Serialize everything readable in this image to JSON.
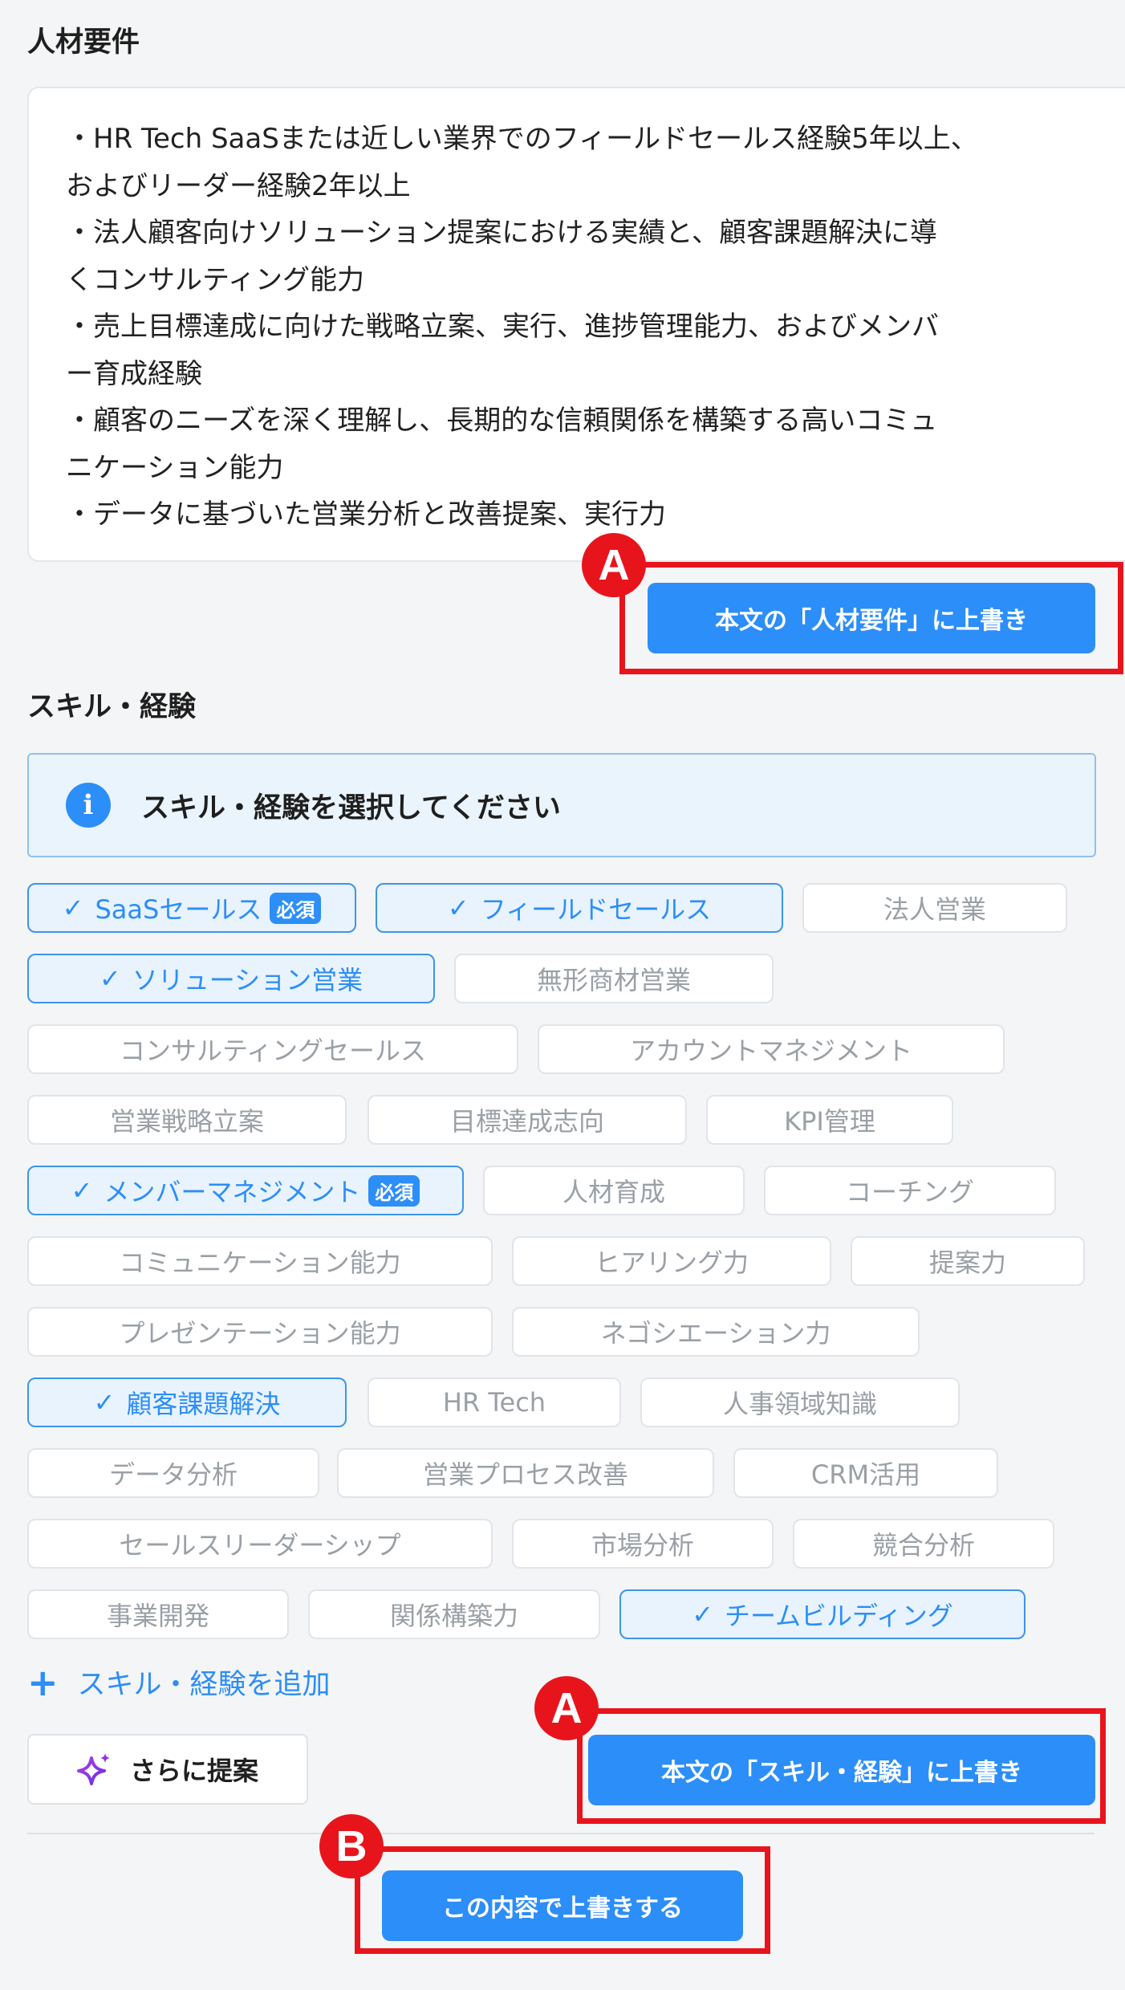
{
  "requirements": {
    "title": "人材要件",
    "lines": [
      "・HR Tech SaaSまたは近しい業界でのフィールドセールス経験5年以上、",
      "およびリーダー経験2年以上",
      "・法人顧客向けソリューション提案における実績と、顧客課題解決に導",
      "くコンサルティング能力",
      "・売上目標達成に向けた戦略立案、実行、進捗管理能力、およびメンバ",
      "ー育成経験",
      "・顧客のニーズを深く理解し、長期的な信頼関係を構築する高いコミュ",
      "ニケーション能力",
      "・データに基づいた営業分析と改善提案、実行力"
    ],
    "overwrite_button": "本文の「人材要件」に上書き"
  },
  "skills": {
    "title": "スキル・経験",
    "info_text": "スキル・経験を選択してください",
    "chips": [
      {
        "label": "SaaSセールス",
        "selected": true,
        "badge": "必須"
      },
      {
        "label": "フィールドセールス",
        "selected": true
      },
      {
        "label": "法人営業",
        "selected": false
      },
      {
        "label": "ソリューション営業",
        "selected": true
      },
      {
        "label": "無形商材営業",
        "selected": false
      },
      {
        "label": "コンサルティングセールス",
        "selected": false
      },
      {
        "label": "アカウントマネジメント",
        "selected": false
      },
      {
        "label": "営業戦略立案",
        "selected": false
      },
      {
        "label": "目標達成志向",
        "selected": false
      },
      {
        "label": "KPI管理",
        "selected": false
      },
      {
        "label": "メンバーマネジメント",
        "selected": true,
        "badge": "必須"
      },
      {
        "label": "人材育成",
        "selected": false
      },
      {
        "label": "コーチング",
        "selected": false
      },
      {
        "label": "コミュニケーション能力",
        "selected": false
      },
      {
        "label": "ヒアリング力",
        "selected": false
      },
      {
        "label": "提案力",
        "selected": false
      },
      {
        "label": "プレゼンテーション能力",
        "selected": false
      },
      {
        "label": "ネゴシエーション力",
        "selected": false
      },
      {
        "label": "顧客課題解決",
        "selected": true
      },
      {
        "label": "HR Tech",
        "selected": false
      },
      {
        "label": "人事領域知識",
        "selected": false
      },
      {
        "label": "データ分析",
        "selected": false
      },
      {
        "label": "営業プロセス改善",
        "selected": false
      },
      {
        "label": "CRM活用",
        "selected": false
      },
      {
        "label": "セールスリーダーシップ",
        "selected": false
      },
      {
        "label": "市場分析",
        "selected": false
      },
      {
        "label": "競合分析",
        "selected": false
      },
      {
        "label": "事業開発",
        "selected": false
      },
      {
        "label": "関係構築力",
        "selected": false
      },
      {
        "label": "チームビルディング",
        "selected": true
      }
    ],
    "add_link": "スキル・経験を追加",
    "suggest_button": "さらに提案",
    "overwrite_button": "本文の「スキル・経験」に上書き"
  },
  "apply_button": "この内容で上書きする",
  "markers": {
    "a": "A",
    "b": "B"
  },
  "colors": {
    "accent": "#2c8ef8",
    "highlight": "#e8141c"
  }
}
